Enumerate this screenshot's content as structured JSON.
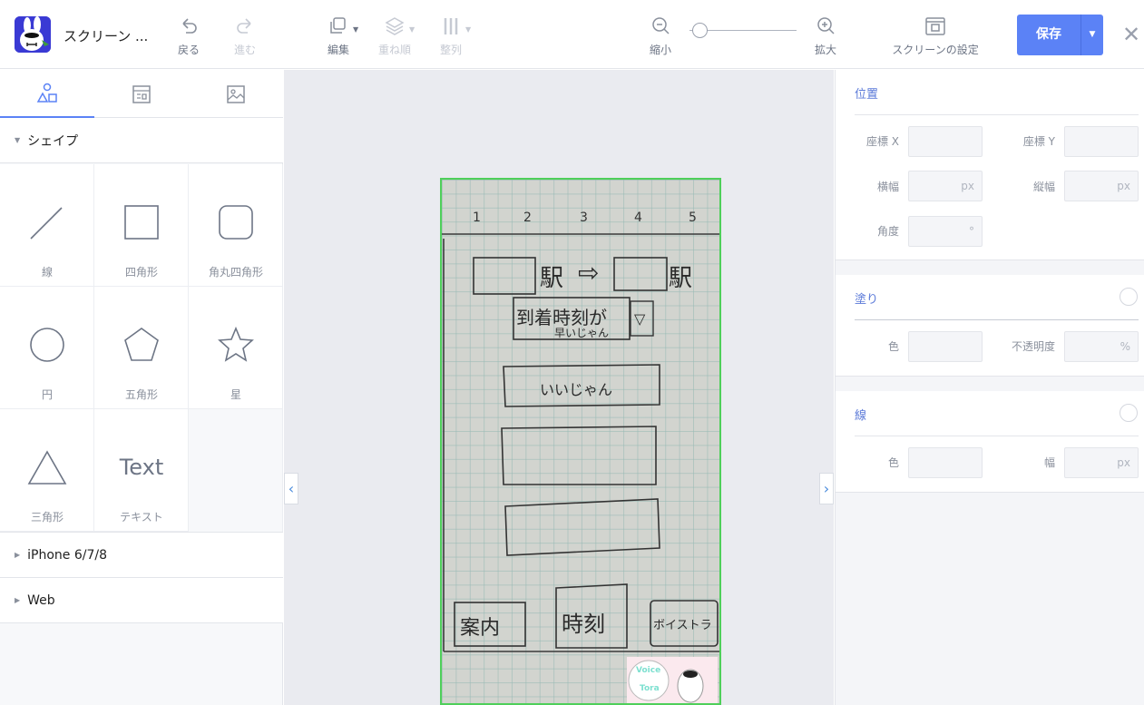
{
  "app": {
    "title": "スクリーン ..."
  },
  "toolbar": {
    "undo": "戻る",
    "redo": "進む",
    "edit": "編集",
    "order": "重ね順",
    "align": "整列",
    "zoom_out": "縮小",
    "zoom_in": "拡大",
    "zoom_level": 0.1,
    "screen_settings": "スクリーンの設定",
    "save": "保存"
  },
  "left_panel": {
    "tabs": [
      "shapes-tab",
      "components-tab",
      "images-tab"
    ],
    "shapes_section": "シェイプ",
    "shapes": [
      {
        "label": "線"
      },
      {
        "label": "四角形"
      },
      {
        "label": "角丸四角形"
      },
      {
        "label": "円"
      },
      {
        "label": "五角形"
      },
      {
        "label": "星"
      },
      {
        "label": "三角形"
      },
      {
        "label": "テキスト",
        "preview": "Text"
      }
    ],
    "sections": [
      "iPhone 6/7/8",
      "Web"
    ]
  },
  "sketch": {
    "column_numbers": [
      "1",
      "2",
      "3",
      "4",
      "5"
    ],
    "station_label": "駅",
    "arrow": "⇨",
    "arrival_button": "到着時刻が",
    "arrival_button_sub": "早いじゃん",
    "dropdown_mark": "▽",
    "field_text": "いいじゃん",
    "nav_items": [
      "案内",
      "時刻",
      "ボイストラ"
    ],
    "sticker_text": [
      "Voice",
      "Tora"
    ]
  },
  "properties": {
    "position_title": "位置",
    "x_label": "座標 X",
    "y_label": "座標 Y",
    "width_label": "横幅",
    "height_label": "縦幅",
    "angle_label": "角度",
    "unit_px": "px",
    "unit_deg": "°",
    "unit_pct": "%",
    "fill_title": "塗り",
    "color_label": "色",
    "opacity_label": "不透明度",
    "stroke_title": "線",
    "stroke_width_label": "幅"
  },
  "colors": {
    "accent": "#5b82f6",
    "selection": "#4fcf5a"
  }
}
